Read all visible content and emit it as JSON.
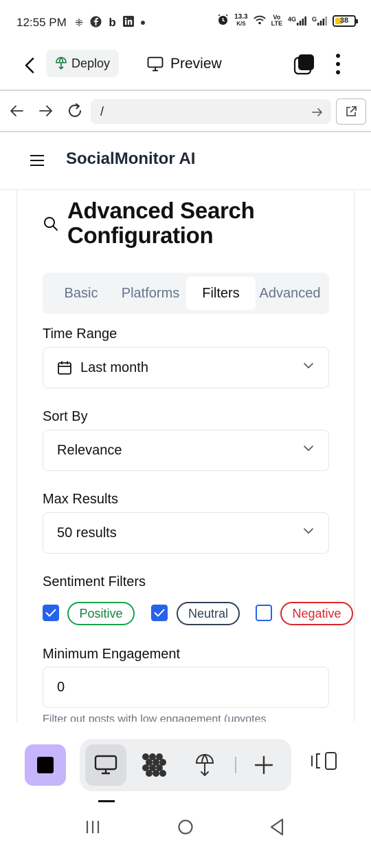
{
  "status_bar": {
    "time": "12:55 PM",
    "net_speed_value": "13.3",
    "net_speed_unit": "K/S",
    "volte": "Vo\nLTE",
    "network_4g": "4G",
    "network_g": "G",
    "battery": "38"
  },
  "browser_toolbar": {
    "deploy_label": "Deploy",
    "preview_label": "Preview"
  },
  "url_bar": {
    "url": "/"
  },
  "site": {
    "brand": "SocialMonitor AI"
  },
  "card": {
    "title": "Advanced Search Configuration",
    "tabs": [
      {
        "label": "Basic",
        "active": false
      },
      {
        "label": "Platforms",
        "active": false
      },
      {
        "label": "Filters",
        "active": true
      },
      {
        "label": "Advanced",
        "active": false
      }
    ],
    "time_range": {
      "label": "Time Range",
      "value": "Last month"
    },
    "sort_by": {
      "label": "Sort By",
      "value": "Relevance"
    },
    "max_results": {
      "label": "Max Results",
      "value": "50 results"
    },
    "sentiment": {
      "label": "Sentiment Filters",
      "options": [
        {
          "label": "Positive",
          "checked": true
        },
        {
          "label": "Neutral",
          "checked": true
        },
        {
          "label": "Negative",
          "checked": false
        }
      ]
    },
    "min_engagement": {
      "label": "Minimum Engagement",
      "value": "0",
      "help": "Filter out posts with low engagement (upvotes"
    }
  },
  "colors": {
    "accent_blue": "#2563eb",
    "positive_green": "#16a34a",
    "negative_red": "#dc2626",
    "stop_purple": "#c4b5fd"
  }
}
